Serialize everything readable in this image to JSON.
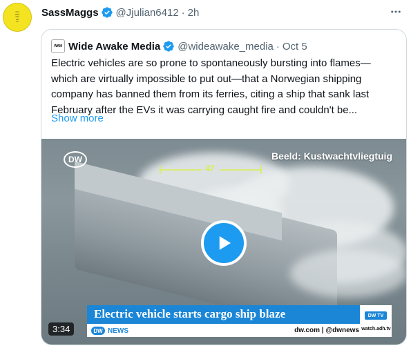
{
  "tweet": {
    "author_name": "SassMaggs",
    "handle": "@Jjulian6412",
    "separator": "·",
    "time": "2h",
    "avatar_icon": "avatar-yellow-badge",
    "verified_color": "#1d9bf0"
  },
  "quote": {
    "author_name": "Wide Awake Media",
    "handle": "@wideawake_media",
    "separator": "·",
    "time": "Oct 5",
    "text": "Electric vehicles are so prone to spontaneously bursting into flames—which are virtually impossible to put out—that a Norwegian shipping company has banned them from its ferries, citing a ship that sank last February after the EVs it was carrying caught fire and couldn't be...",
    "show_more": "Show more",
    "link_color": "#1d9bf0"
  },
  "video": {
    "credit": "Beeld: Kustwachtvliegtuig",
    "measure_label": "47",
    "dw_logo": "DW",
    "headline": "Electric vehicle starts cargo ship blaze",
    "news_label": "NEWS",
    "news_logo": "DW",
    "lower_right": "dw.com | @dwnews",
    "watch_badge": "DW TV",
    "watch_url": "watch.adh.tv",
    "duration": "3:34",
    "accent": "#1b86d6"
  }
}
